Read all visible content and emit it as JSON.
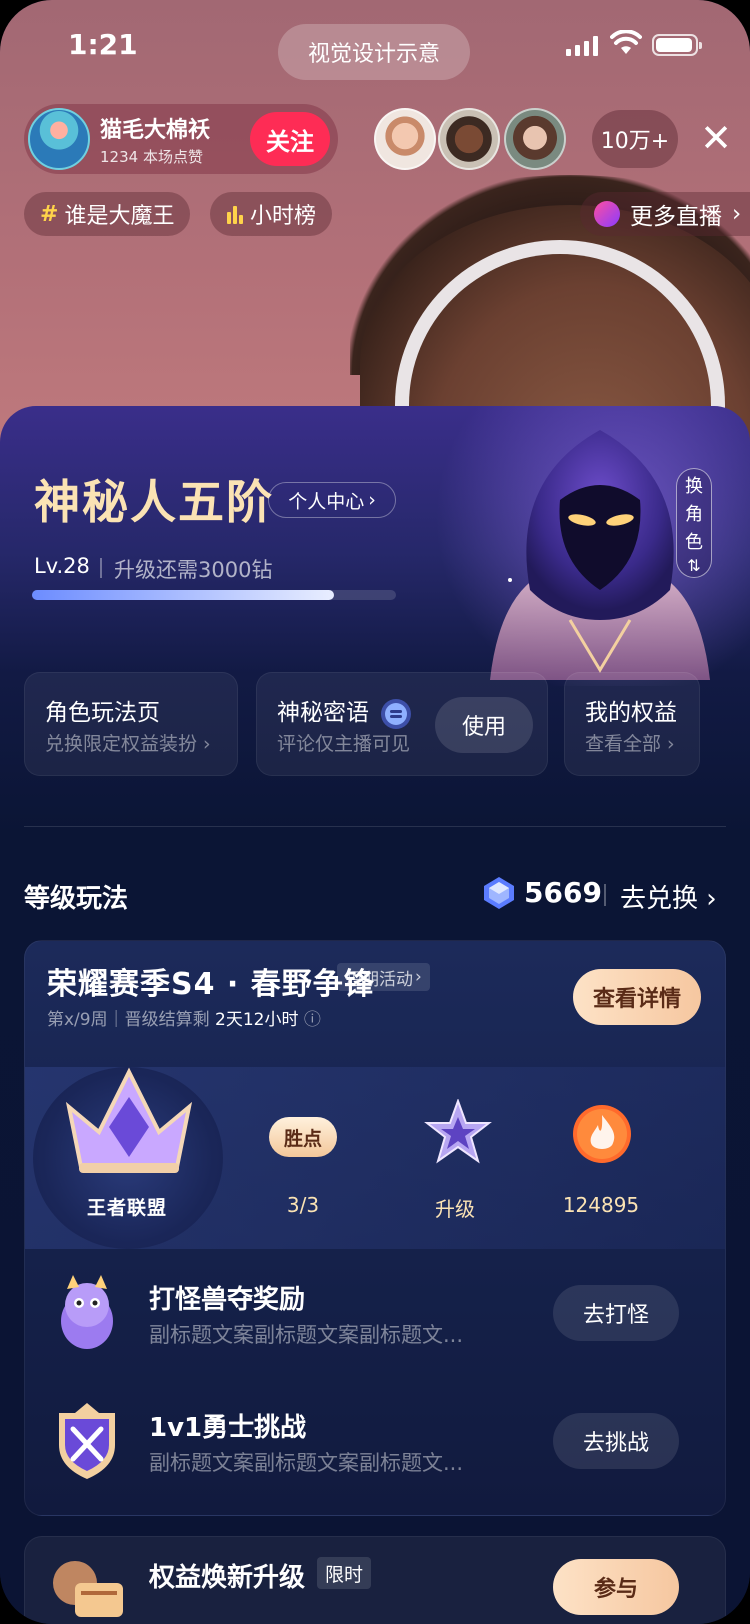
{
  "status_bar": {
    "time": "1:21",
    "island_label": "视觉设计示意"
  },
  "host": {
    "name": "猫毛大棉袄",
    "likes": "1234 本场点赞",
    "follow_label": "关注"
  },
  "viewers": {
    "count": "10万+"
  },
  "tags": [
    {
      "icon": "hash-icon",
      "label": "谁是大魔王"
    },
    {
      "icon": "bar-chart-icon",
      "label": "小时榜"
    }
  ],
  "more_live": {
    "label": "更多直播"
  },
  "profile": {
    "title": "神秘人五阶",
    "center_link": "个人中心",
    "level": "Lv.28",
    "upgrade_need": "升级还需3000钻",
    "progress_fraction": 0.83,
    "swap_label": [
      "换",
      "角",
      "色"
    ]
  },
  "cards": [
    {
      "title": "角色玩法页",
      "sub": "兑换限定权益装扮"
    },
    {
      "title": "神秘密语",
      "sub": "评论仅主播可见",
      "button": "使用"
    },
    {
      "title": "我的权益",
      "sub": "查看全部"
    }
  ],
  "section": {
    "title": "等级玩法",
    "diamonds": "5669",
    "exchange": "去兑换"
  },
  "season": {
    "title": "荣耀赛季S4 · 春野争锋",
    "tag": "短期活动",
    "week": "第x/9周｜晋级结算剩",
    "remain": "2天12小时",
    "detail_button": "查看详情",
    "rank_name": "王者联盟",
    "win_label": "胜点",
    "stats": [
      {
        "name": "win-points",
        "value": "3/3"
      },
      {
        "name": "upgrade",
        "value": "升级"
      },
      {
        "name": "fire",
        "value": "124895"
      }
    ]
  },
  "tasks": [
    {
      "title": "打怪兽夺奖励",
      "sub": "副标题文案副标题文案副标题文...",
      "button": "去打怪"
    },
    {
      "title": "1v1勇士挑战",
      "sub": "副标题文案副标题文案副标题文...",
      "button": "去挑战"
    }
  ],
  "promo": {
    "title": "权益焕新升级",
    "tag": "限时",
    "button": "参与"
  },
  "colors": {
    "accent_pink": "#fe2c55",
    "gold_text": "#fbe3b4",
    "sheet_bg": "#0b1434"
  }
}
